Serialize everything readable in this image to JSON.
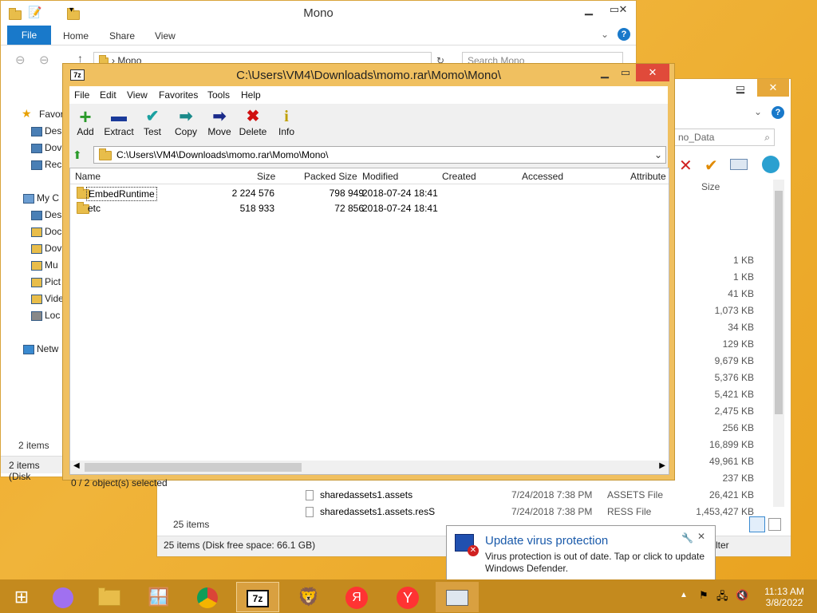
{
  "explorer1": {
    "title": "Mono",
    "tabs": [
      "File",
      "Home",
      "Share",
      "View"
    ],
    "address": "Mono",
    "search_placeholder": "Search Mono",
    "sidebar": [
      "Favor",
      "Des",
      "Dov",
      "Rec",
      "My C",
      "Des",
      "Doc",
      "Dov",
      "Mu",
      "Pict",
      "Vide",
      "Loc",
      "Netw"
    ],
    "status_items": "2 items",
    "status_bar": "2 items (Disk"
  },
  "explorer2": {
    "search_placeholder": "no_Data",
    "size_header": "Size",
    "sizes": [
      "1 KB",
      "1 KB",
      "41 KB",
      "1,073 KB",
      "34 KB",
      "129 KB",
      "9,679 KB",
      "5,376 KB",
      "5,421 KB",
      "2,475 KB",
      "256 KB",
      "16,899 KB",
      "49,961 KB",
      "237 KB"
    ],
    "rows": [
      {
        "name": "sharedassets1.assets",
        "date": "7/24/2018 7:38 PM",
        "type": "ASSETS File",
        "size": "26,421 KB"
      },
      {
        "name": "sharedassets1.assets.resS",
        "date": "7/24/2018 7:38 PM",
        "type": "RESS File",
        "size": "1,453,427 KB"
      }
    ],
    "status_items": "25 items",
    "status_bar": "25 items (Disk free space: 66.1 GB)",
    "filter": "lter"
  },
  "zip": {
    "title": "C:\\Users\\VM4\\Downloads\\momo.rar\\Momo\\Mono\\",
    "icon_label": "7z",
    "menu": [
      "File",
      "Edit",
      "View",
      "Favorites",
      "Tools",
      "Help"
    ],
    "tools": [
      {
        "label": "Add",
        "glyph": "+",
        "color": "#2a9a2a"
      },
      {
        "label": "Extract",
        "glyph": "▬",
        "color": "#1a3a9a"
      },
      {
        "label": "Test",
        "glyph": "✔",
        "color": "#1aa0a0"
      },
      {
        "label": "Copy",
        "glyph": "➡",
        "color": "#1a8a8a"
      },
      {
        "label": "Move",
        "glyph": "➡",
        "color": "#1a2a8a"
      },
      {
        "label": "Delete",
        "glyph": "✖",
        "color": "#d01010"
      },
      {
        "label": "Info",
        "glyph": "i",
        "color": "#c0a000"
      }
    ],
    "path": "C:\\Users\\VM4\\Downloads\\momo.rar\\Momo\\Mono\\",
    "columns": [
      "Name",
      "Size",
      "Packed Size",
      "Modified",
      "Created",
      "Accessed",
      "Attribute"
    ],
    "files": [
      {
        "name": "EmbedRuntime",
        "size": "2 224 576",
        "packed": "798 949",
        "modified": "2018-07-24 18:41"
      },
      {
        "name": "etc",
        "size": "518 933",
        "packed": "72 856",
        "modified": "2018-07-24 18:41"
      }
    ],
    "status": "0 / 2 object(s) selected"
  },
  "notification": {
    "title": "Update virus protection",
    "body1": "Virus protection is out of date. Tap or click to update",
    "body2": "Windows Defender."
  },
  "clock": {
    "time": "11:13 AM",
    "date": "3/8/2022"
  }
}
